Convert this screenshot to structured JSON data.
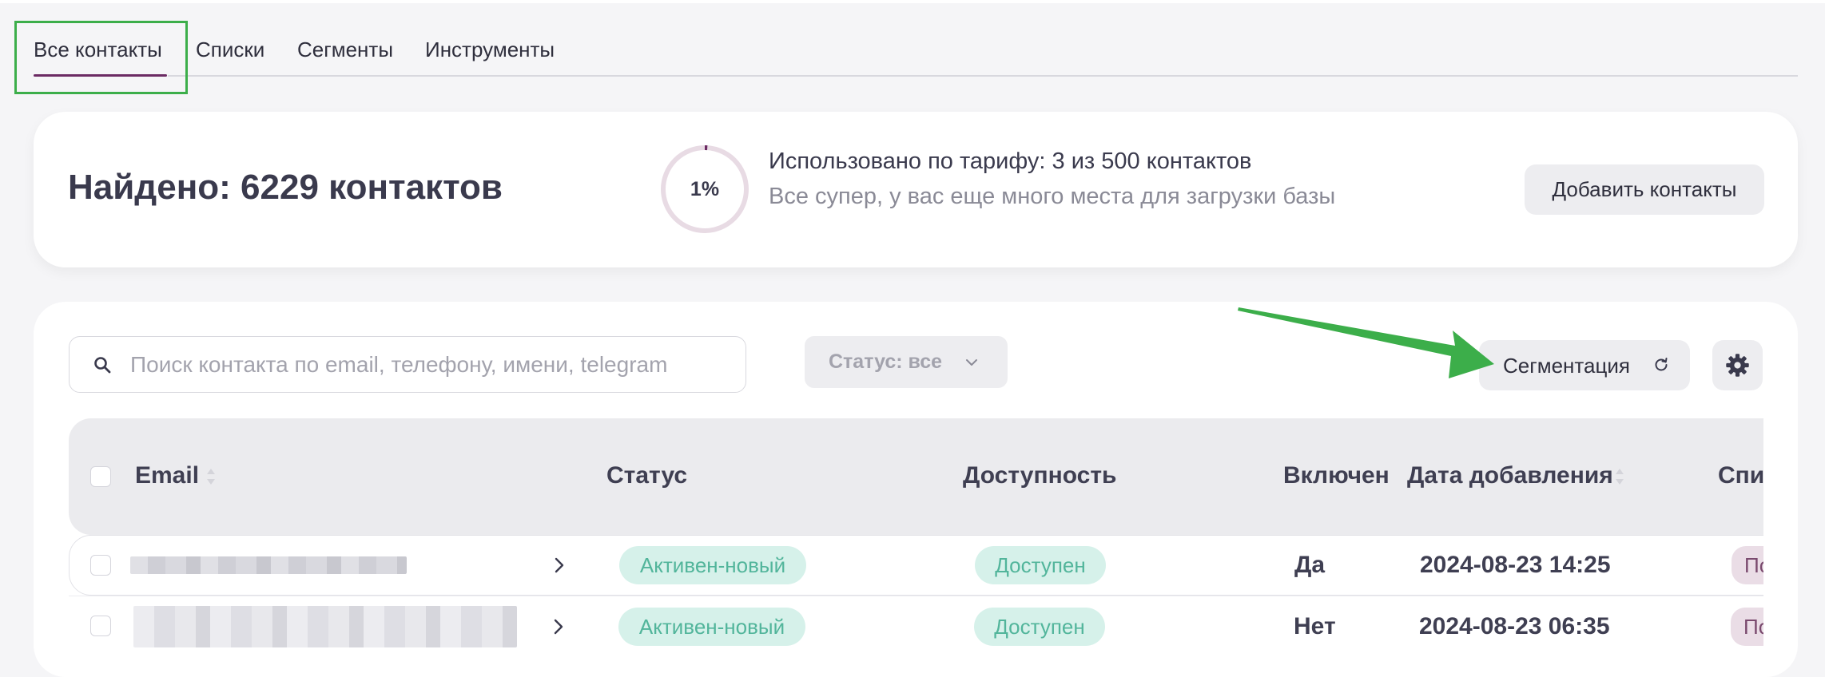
{
  "tabs": [
    {
      "label": "Все контакты",
      "active": true
    },
    {
      "label": "Списки",
      "active": false
    },
    {
      "label": "Сегменты",
      "active": false
    },
    {
      "label": "Инструменты",
      "active": false
    }
  ],
  "summary": {
    "found_text": "Найдено: 6229 контактов",
    "usage_percent": 1,
    "usage_percent_label": "1%",
    "usage_line": "Использовано по тарифу: 3 из 500 контактов",
    "usage_note": "Все супер, у вас еще много места для загрузки базы",
    "add_button": "Добавить контакты"
  },
  "toolbar": {
    "search_placeholder": "Поиск контакта по email, телефону, имени, telegram",
    "search_value": "",
    "status_filter_label": "Статус: все",
    "segmentation_button": "Сегментация"
  },
  "table": {
    "columns": [
      "Email",
      "Статус",
      "Доступность",
      "Включен",
      "Дата добавления",
      "Спи"
    ],
    "rows": [
      {
        "status": "Активен-новый",
        "availability": "Доступен",
        "enabled": "Да",
        "date_added": "2024-08-23 14:25",
        "list": "По"
      },
      {
        "status": "Активен-новый",
        "availability": "Доступен",
        "enabled": "Нет",
        "date_added": "2024-08-23 06:35",
        "list": "По"
      }
    ]
  },
  "colors": {
    "accent": "#6b2a63",
    "annotation_green": "#3cae4a",
    "badge_bg": "#d6f1ea",
    "badge_text": "#52b59b",
    "button_bg": "#ededf0"
  },
  "icons": {
    "search": "search-icon",
    "chevron": "chevron-down-icon",
    "refresh": "refresh-icon",
    "settings": "gear-icon",
    "sort": "sort-icon",
    "row_expand": "chevron-right-icon"
  }
}
